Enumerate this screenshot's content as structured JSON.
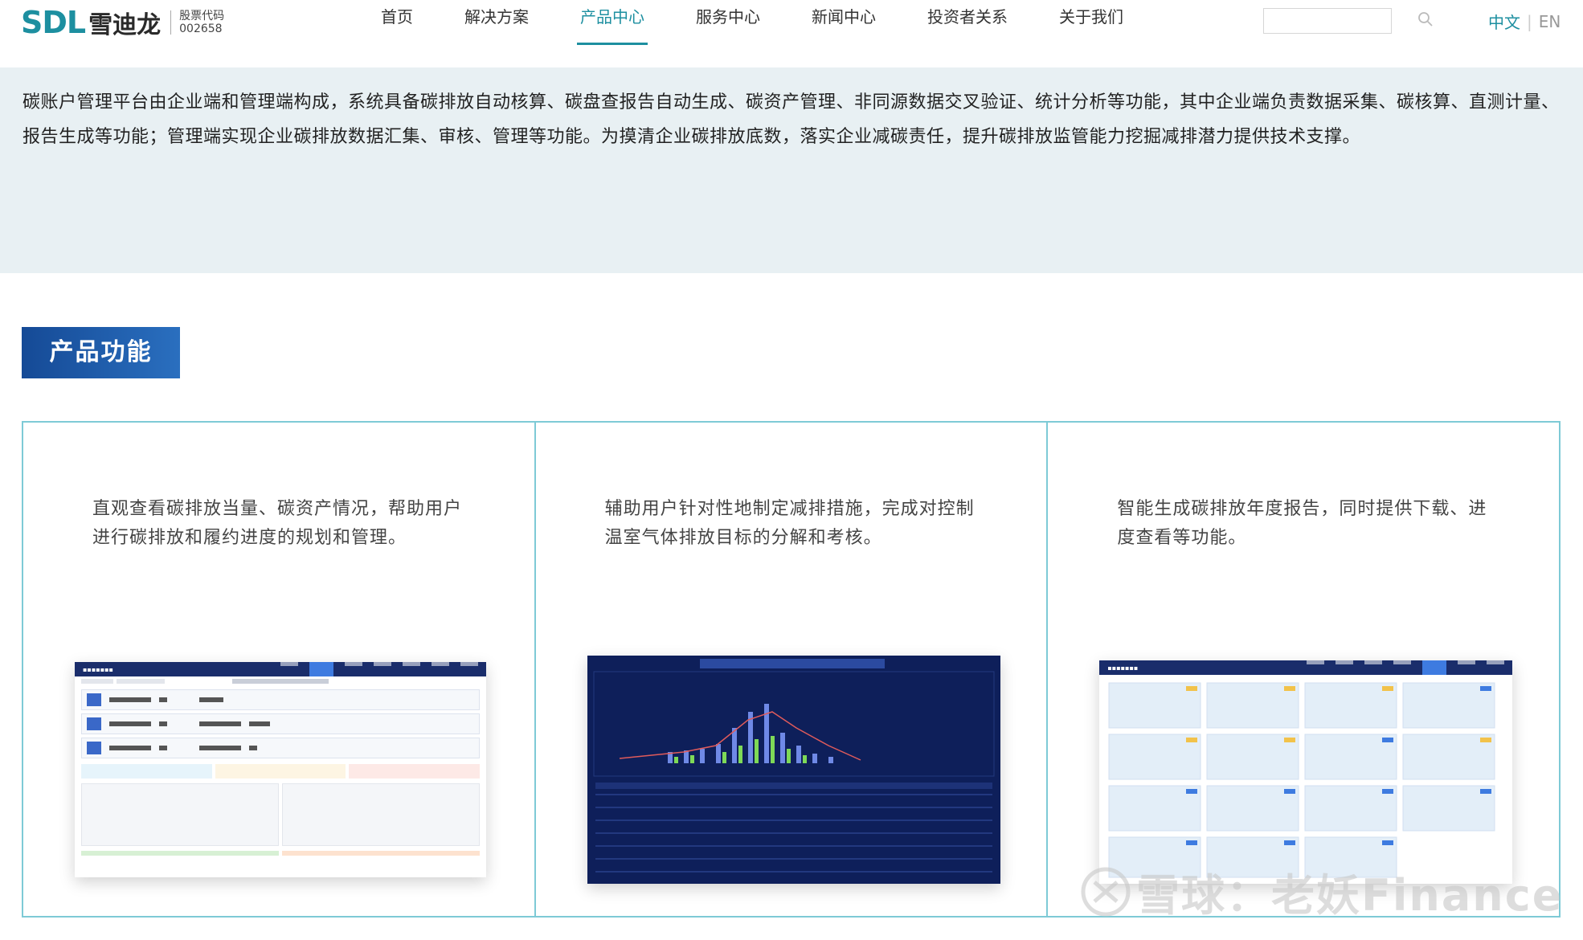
{
  "header": {
    "logo_sdl": "SDL",
    "logo_cn": "雪迪龙",
    "stock_label": "股票代码",
    "stock_code": "002658",
    "nav": [
      {
        "label": "首页",
        "active": false
      },
      {
        "label": "解决方案",
        "active": false
      },
      {
        "label": "产品中心",
        "active": true
      },
      {
        "label": "服务中心",
        "active": false
      },
      {
        "label": "新闻中心",
        "active": false
      },
      {
        "label": "投资者关系",
        "active": false
      },
      {
        "label": "关于我们",
        "active": false
      }
    ],
    "search_placeholder": "",
    "lang_zh": "中文",
    "lang_sep": "|",
    "lang_en": "EN"
  },
  "intro": {
    "text": "碳账户管理平台由企业端和管理端构成，系统具备碳排放自动核算、碳盘查报告自动生成、碳资产管理、非同源数据交叉验证、统计分析等功能，其中企业端负责数据采集、碳核算、直测计量、报告生成等功能；管理端实现企业碳排放数据汇集、审核、管理等功能。为摸清企业碳排放底数，落实企业减碳责任，提升碳排放监管能力挖掘减排潜力提供技术支撑。"
  },
  "section": {
    "title": "产品功能"
  },
  "features": [
    {
      "text": "直观查看碳排放当量、碳资产情况，帮助用户进行碳排放和履约进度的规划和管理。"
    },
    {
      "text": "辅助用户针对性地制定减排措施，完成对控制温室气体排放目标的分解和考核。"
    },
    {
      "text": "智能生成碳排放年度报告，同时提供下载、进度查看等功能。"
    }
  ],
  "watermark": {
    "text": "雪球：老妖Finance"
  },
  "colors": {
    "brand_teal": "#1d8fa0",
    "intro_bg": "#e8f0f3",
    "section_title_bg": "#1f5aa8",
    "grid_border": "#7ecad6"
  }
}
